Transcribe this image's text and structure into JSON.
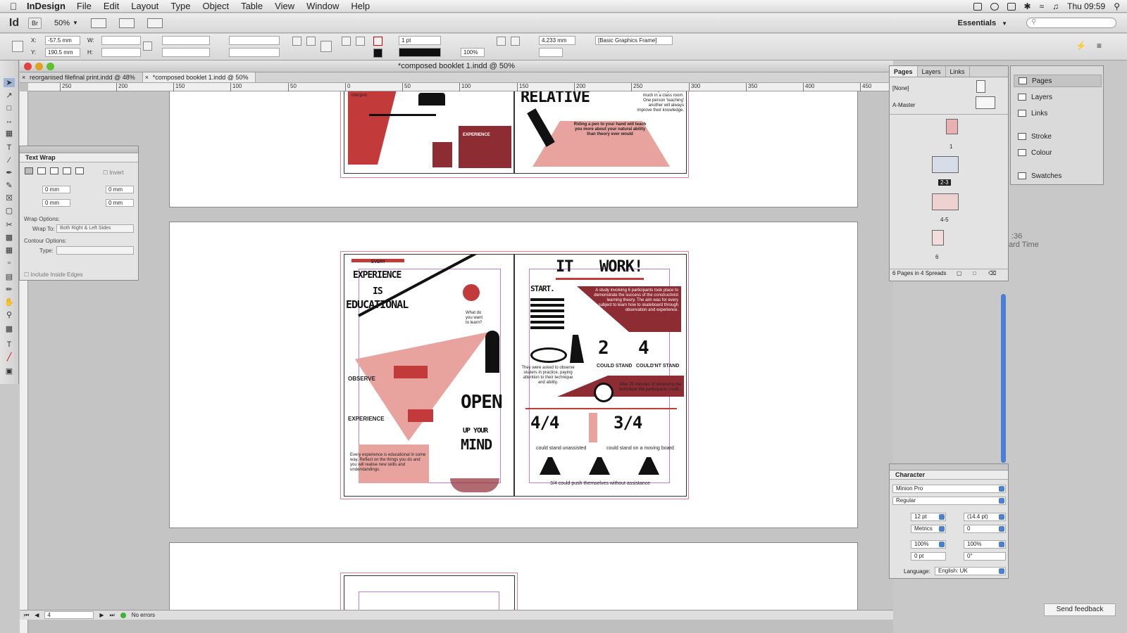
{
  "menubar": {
    "app": "InDesign",
    "items": [
      "File",
      "Edit",
      "Layout",
      "Type",
      "Object",
      "Table",
      "View",
      "Window",
      "Help"
    ],
    "clock": "Thu 09:59"
  },
  "appbar": {
    "logo": "Id",
    "bridge": "Br",
    "zoom": "50%",
    "workspace": "Essentials"
  },
  "control": {
    "x_label": "X:",
    "x_value": "-57.5 mm",
    "y_label": "Y:",
    "y_value": "190.5 mm",
    "w_label": "W:",
    "h_label": "H:",
    "stroke_weight": "1 pt",
    "scale": "100%",
    "ref_value": "4.233 mm",
    "object_style": "[Basic Graphics Frame]"
  },
  "document": {
    "title": "*composed booklet 1.indd @ 50%",
    "tabs": [
      {
        "label": "reorganised filefinal print.indd @ 48%"
      },
      {
        "label": "*composed booklet 1.indd @ 50%"
      }
    ],
    "ruler_ticks": [
      "250",
      "200",
      "150",
      "100",
      "50",
      "0",
      "50",
      "100",
      "150",
      "200",
      "250",
      "300",
      "350",
      "400",
      "450"
    ],
    "status": {
      "page": "4",
      "errors": "No errors"
    }
  },
  "text_wrap": {
    "title": "Text Wrap",
    "invert": "Invert",
    "offset_top": "0 mm",
    "offset_bottom": "0 mm",
    "offset_left": "0 mm",
    "offset_right": "0 mm",
    "wrap_options": "Wrap Options:",
    "wrap_to_label": "Wrap To:",
    "wrap_to_value": "Both Right & Left Sides",
    "contour_options": "Contour Options:",
    "type_label": "Type:",
    "include_inside": "Include Inside Edges"
  },
  "pages_panel": {
    "tabs": [
      "Pages",
      "Layers",
      "Links"
    ],
    "none": "[None]",
    "master": "A-Master",
    "page_labels": [
      "1",
      "2-3",
      "4-5",
      "6"
    ],
    "footer": "6 Pages in 4 Spreads"
  },
  "dock": {
    "items": [
      "Pages",
      "Layers",
      "Links",
      "Stroke",
      "Colour",
      "Swatches"
    ]
  },
  "character": {
    "title": "Character",
    "font": "Minion Pro",
    "style": "Regular",
    "size": "12 pt",
    "leading": "(14.4 pt)",
    "kerning": "Metrics",
    "tracking": "0",
    "vscale": "100%",
    "hscale": "100%",
    "baseline": "0 pt",
    "skew": "0°",
    "language_label": "Language:",
    "language": "English: UK"
  },
  "background": {
    "time_a": ":36",
    "time_b": "ard Time",
    "feedback": "Send feedback"
  },
  "artwork": {
    "top_right_title": "RELATIVE",
    "top_left_text": "should look at and interpret",
    "top_left_word": "EXPERIENCE",
    "top_right_caption": "Riding a pen to your hand will teach you more about your natural ability than theory ever would",
    "top_right_side": "The way they learn is much in a class room. One person 'teaching' another will always improve their knowledge.",
    "left_small": "EVERY",
    "left_h1": "EXPERIENCE",
    "left_h2": "IS",
    "left_h3": "EDUCATIONAL",
    "question": "What do you want to learn?",
    "observe": "OBSERVE",
    "experience": "EXPERIENCE",
    "open": "OPEN",
    "your": "UP YOUR",
    "mind": "MIND",
    "left_body": "Every experience is educational in some way. Reflect on the things you do and you will realise new skills and understandings.",
    "right_title_a": "IT",
    "right_title_b": "WORK!",
    "start": "START.",
    "study": "A study involving 6 participants took place to demonstrate the success of the constructivist learning theory. The aim was for every subject to learn how to skateboard through observation and experience.",
    "eye_text": "They were asked to observe skaters in practice, paying attention to their technique and ability.",
    "two": "2",
    "four": "4",
    "could_stand": "COULD STAND",
    "couldnt_stand": "COULD'NT STAND",
    "after": "After 20 minutes of observing the technique the participants could...",
    "frac1": "4/4",
    "frac2": "3/4",
    "stand_un": "could stand unassisted",
    "stand_board": "could stand on a moving board",
    "push": "3/4 could push themselves without assistance"
  }
}
